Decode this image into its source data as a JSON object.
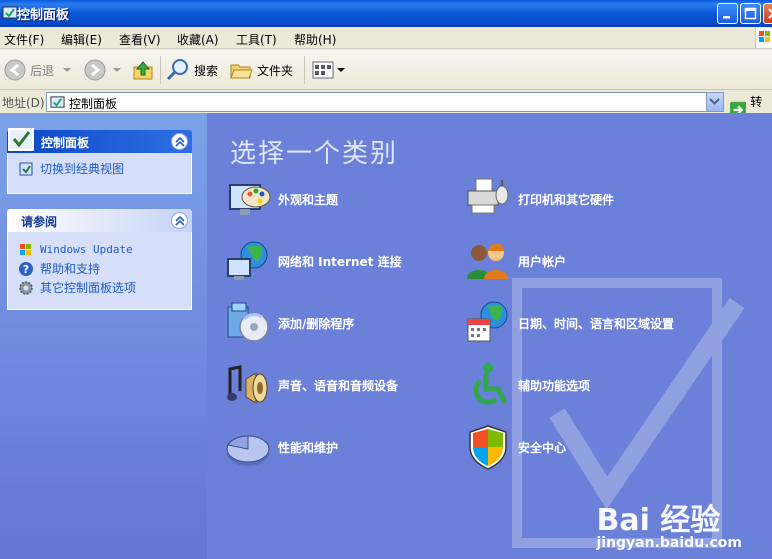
{
  "window": {
    "title": "控制面板"
  },
  "menubar": {
    "items": [
      "文件(F)",
      "编辑(E)",
      "查看(V)",
      "收藏(A)",
      "工具(T)",
      "帮助(H)"
    ]
  },
  "toolbar": {
    "back_label": "后退",
    "search_label": "搜索",
    "folders_label": "文件夹"
  },
  "addressbar": {
    "label": "地址(D)",
    "value": "控制面板",
    "go_label": "转到"
  },
  "taskpane": {
    "control_panel": {
      "header": "控制面板",
      "link": "切换到经典视图"
    },
    "see_also": {
      "header": "请参阅",
      "links": [
        "Windows Update",
        "帮助和支持",
        "其它控制面板选项"
      ]
    }
  },
  "main": {
    "title": "选择一个类别",
    "categories": [
      {
        "label": "外观和主题",
        "icon": "appearance-themes-icon"
      },
      {
        "label": "打印机和其它硬件",
        "icon": "printer-hardware-icon"
      },
      {
        "label": "网络和 Internet 连接",
        "icon": "network-internet-icon"
      },
      {
        "label": "用户帐户",
        "icon": "user-accounts-icon"
      },
      {
        "label": "添加/删除程序",
        "icon": "add-remove-programs-icon"
      },
      {
        "label": "日期、时间、语言和区域设置",
        "icon": "date-time-language-icon"
      },
      {
        "label": "声音、语音和音频设备",
        "icon": "sounds-audio-icon"
      },
      {
        "label": "辅助功能选项",
        "icon": "accessibility-icon"
      },
      {
        "label": "性能和维护",
        "icon": "performance-maintenance-icon"
      },
      {
        "label": "安全中心",
        "icon": "security-center-icon"
      }
    ]
  },
  "watermark": {
    "brand": "Bai  经验",
    "url": "jingyan.baidu.com"
  },
  "colors": {
    "titlebar": "#0a58d6",
    "taskpane": "#6375d6",
    "main_bg": "#6b80d8",
    "link": "#215dc6"
  }
}
